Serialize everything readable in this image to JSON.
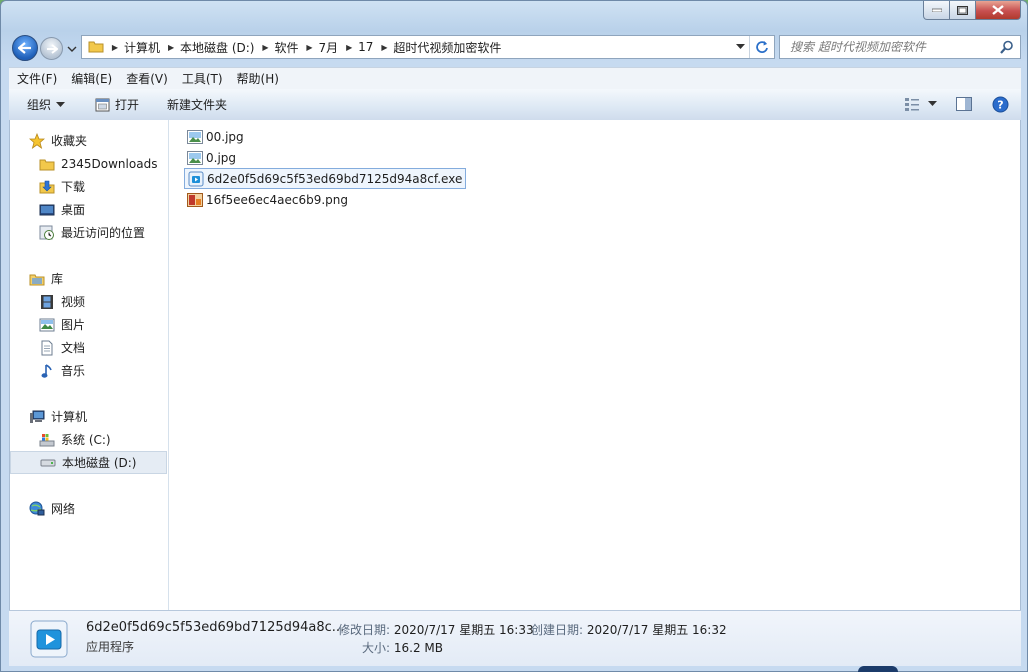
{
  "window": {
    "caption": {
      "minimize": "minimize",
      "maximize": "maximize",
      "close": "close"
    }
  },
  "address": {
    "crumbs": [
      "计算机",
      "本地磁盘 (D:)",
      "软件",
      "7月",
      "17",
      "超时代视频加密软件"
    ]
  },
  "search": {
    "placeholder": "搜索 超时代视频加密软件"
  },
  "menu": [
    "文件(F)",
    "编辑(E)",
    "查看(V)",
    "工具(T)",
    "帮助(H)"
  ],
  "toolbar": {
    "organize": "组织",
    "open": "打开",
    "new_folder": "新建文件夹"
  },
  "nav": {
    "favorites": {
      "label": "收藏夹",
      "items": [
        "2345Downloads",
        "下载",
        "桌面",
        "最近访问的位置"
      ]
    },
    "libraries": {
      "label": "库",
      "items": [
        "视频",
        "图片",
        "文档",
        "音乐"
      ]
    },
    "computer": {
      "label": "计算机",
      "items": [
        "系统 (C:)",
        "本地磁盘 (D:)"
      ]
    },
    "network": {
      "label": "网络"
    }
  },
  "files": [
    {
      "name": "00.jpg",
      "kind": "image"
    },
    {
      "name": "0.jpg",
      "kind": "image"
    },
    {
      "name": "6d2e0f5d69c5f53ed69bd7125d94a8cf.exe",
      "kind": "exe"
    },
    {
      "name": "16f5ee6ec4aec6b9.png",
      "kind": "png"
    }
  ],
  "details": {
    "name": "6d2e0f5d69c5f53ed69bd7125d94a8c...",
    "type": "应用程序",
    "modified_label": "修改日期:",
    "modified_value": "2020/7/17 星期五 16:33",
    "created_label": "创建日期:",
    "created_value": "2020/7/17 星期五 16:32",
    "size_label": "大小:",
    "size_value": "16.2 MB"
  }
}
